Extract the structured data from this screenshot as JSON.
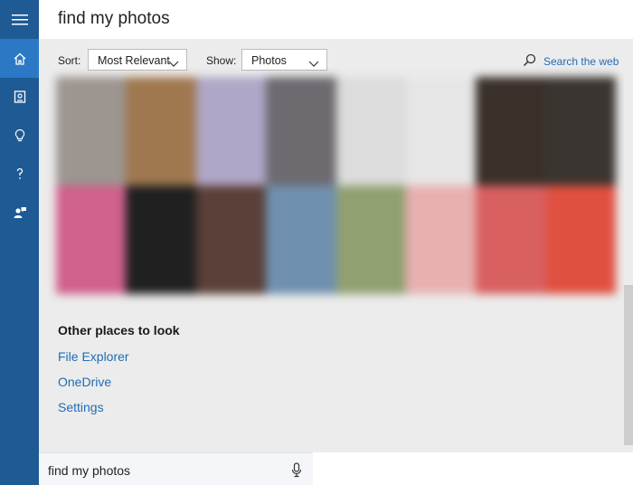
{
  "search": {
    "title": "find my photos",
    "query": "find my photos"
  },
  "filters": {
    "sort_label": "Sort:",
    "sort_value": "Most Relevant",
    "show_label": "Show:",
    "show_value": "Photos",
    "search_web": "Search the web"
  },
  "other_places": {
    "title": "Other places to look",
    "links": [
      "File Explorer",
      "OneDrive",
      "Settings"
    ]
  },
  "rail": {
    "icons": [
      "hamburger-menu-icon",
      "home-icon",
      "notebook-icon",
      "lightbulb-icon",
      "help-icon",
      "feedback-icon"
    ]
  },
  "accent_color": "#1e5a94",
  "link_color": "#1f6cb6",
  "photo_tiles": [
    "#9c9590",
    "#a07850",
    "#b0a6c8",
    "#6d6a70",
    "#dcdcdc",
    "#e6e6e6",
    "#3a302a",
    "#3a3530",
    "#d0608c",
    "#202020",
    "#5a4038",
    "#7090b0",
    "#90a070",
    "#e8b0b0",
    "#d86060",
    "#e05040"
  ]
}
